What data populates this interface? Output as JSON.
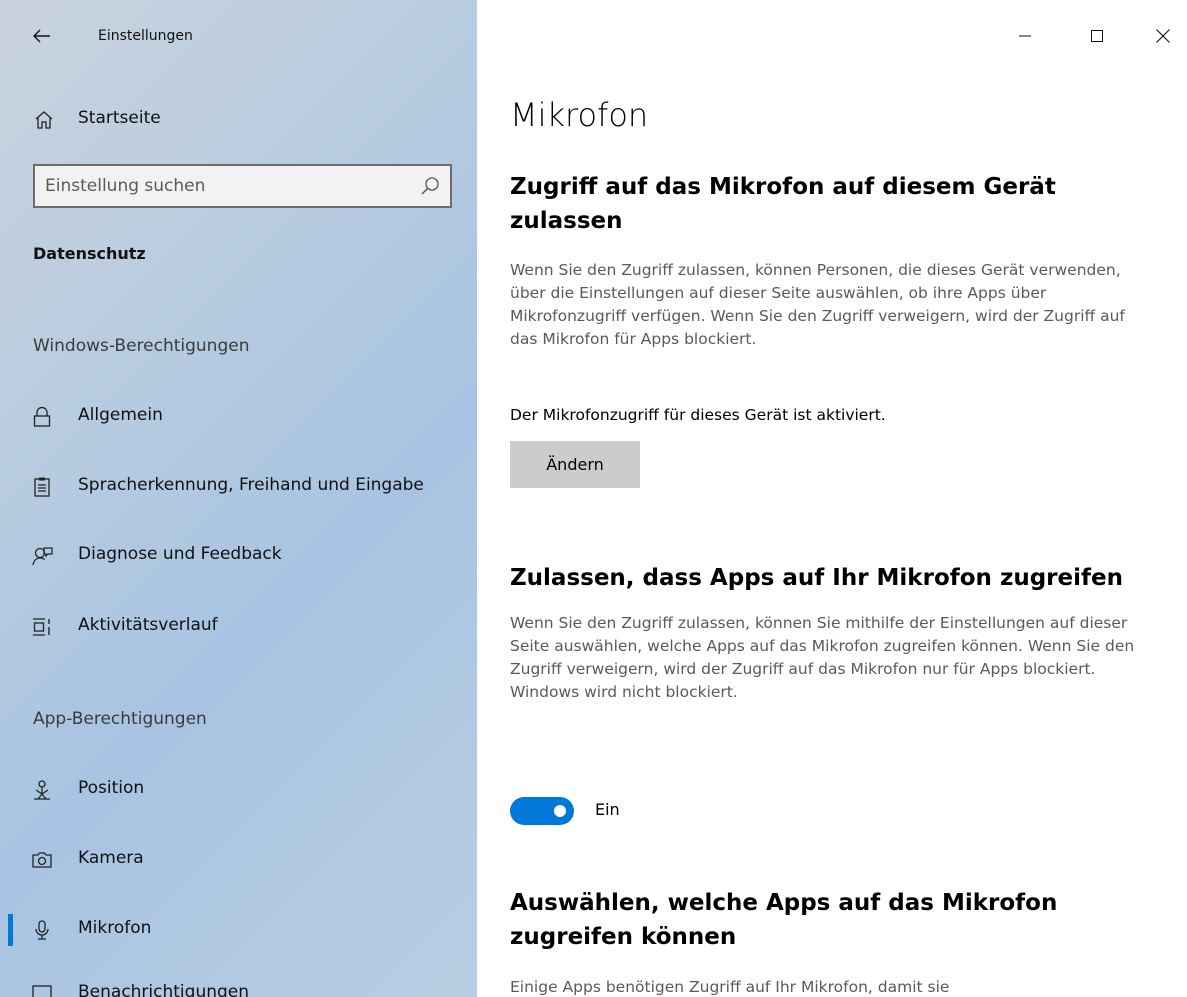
{
  "window": {
    "title": "Einstellungen",
    "controls": {
      "minimize": "—",
      "maximize": "☐",
      "close": "✕"
    }
  },
  "sidebar": {
    "home_label": "Startseite",
    "search_placeholder": "Einstellung suchen",
    "category": "Datenschutz",
    "sections": [
      {
        "heading": "Windows-Berechtigungen",
        "items": [
          {
            "label": "Allgemein",
            "icon": "lock-icon"
          },
          {
            "label": "Spracherkennung, Freihand und Eingabe",
            "icon": "clipboard-icon"
          },
          {
            "label": "Diagnose und Feedback",
            "icon": "feedback-icon"
          },
          {
            "label": "Aktivitätsverlauf",
            "icon": "activity-icon"
          }
        ]
      },
      {
        "heading": "App-Berechtigungen",
        "items": [
          {
            "label": "Position",
            "icon": "location-icon"
          },
          {
            "label": "Kamera",
            "icon": "camera-icon"
          },
          {
            "label": "Mikrofon",
            "icon": "microphone-icon",
            "active": true
          },
          {
            "label": "Benachrichtigungen",
            "icon": "notifications-icon"
          }
        ]
      }
    ]
  },
  "main": {
    "title": "Mikrofon",
    "device_access": {
      "heading": "Zugriff auf das Mikrofon auf diesem Gerät zulassen",
      "description": "Wenn Sie den Zugriff zulassen, können Personen, die dieses Gerät verwenden, über die Einstellungen auf dieser Seite auswählen, ob ihre Apps über Mikrofonzugriff verfügen. Wenn Sie den Zugriff verweigern, wird der Zugriff auf das Mikrofon für Apps blockiert.",
      "status": "Der Mikrofonzugriff für dieses Gerät ist aktiviert.",
      "button": "Ändern"
    },
    "app_access": {
      "heading": "Zulassen, dass Apps auf Ihr Mikrofon zugreifen",
      "description": "Wenn Sie den Zugriff zulassen, können Sie mithilfe der Einstellungen auf dieser Seite auswählen, welche Apps auf das Mikrofon zugreifen können. Wenn Sie den Zugriff verweigern, wird der Zugriff auf das Mikrofon nur für Apps blockiert. Windows wird nicht blockiert.",
      "toggle_state": "on",
      "toggle_label": "Ein"
    },
    "choose_apps": {
      "heading": "Auswählen, welche Apps auf das Mikrofon zugreifen können",
      "description": "Einige Apps benötigen Zugriff auf Ihr Mikrofon, damit sie"
    }
  },
  "colors": {
    "accent": "#0078d7",
    "button_bg": "#cccccc",
    "desc_text": "#5a5a5a"
  }
}
